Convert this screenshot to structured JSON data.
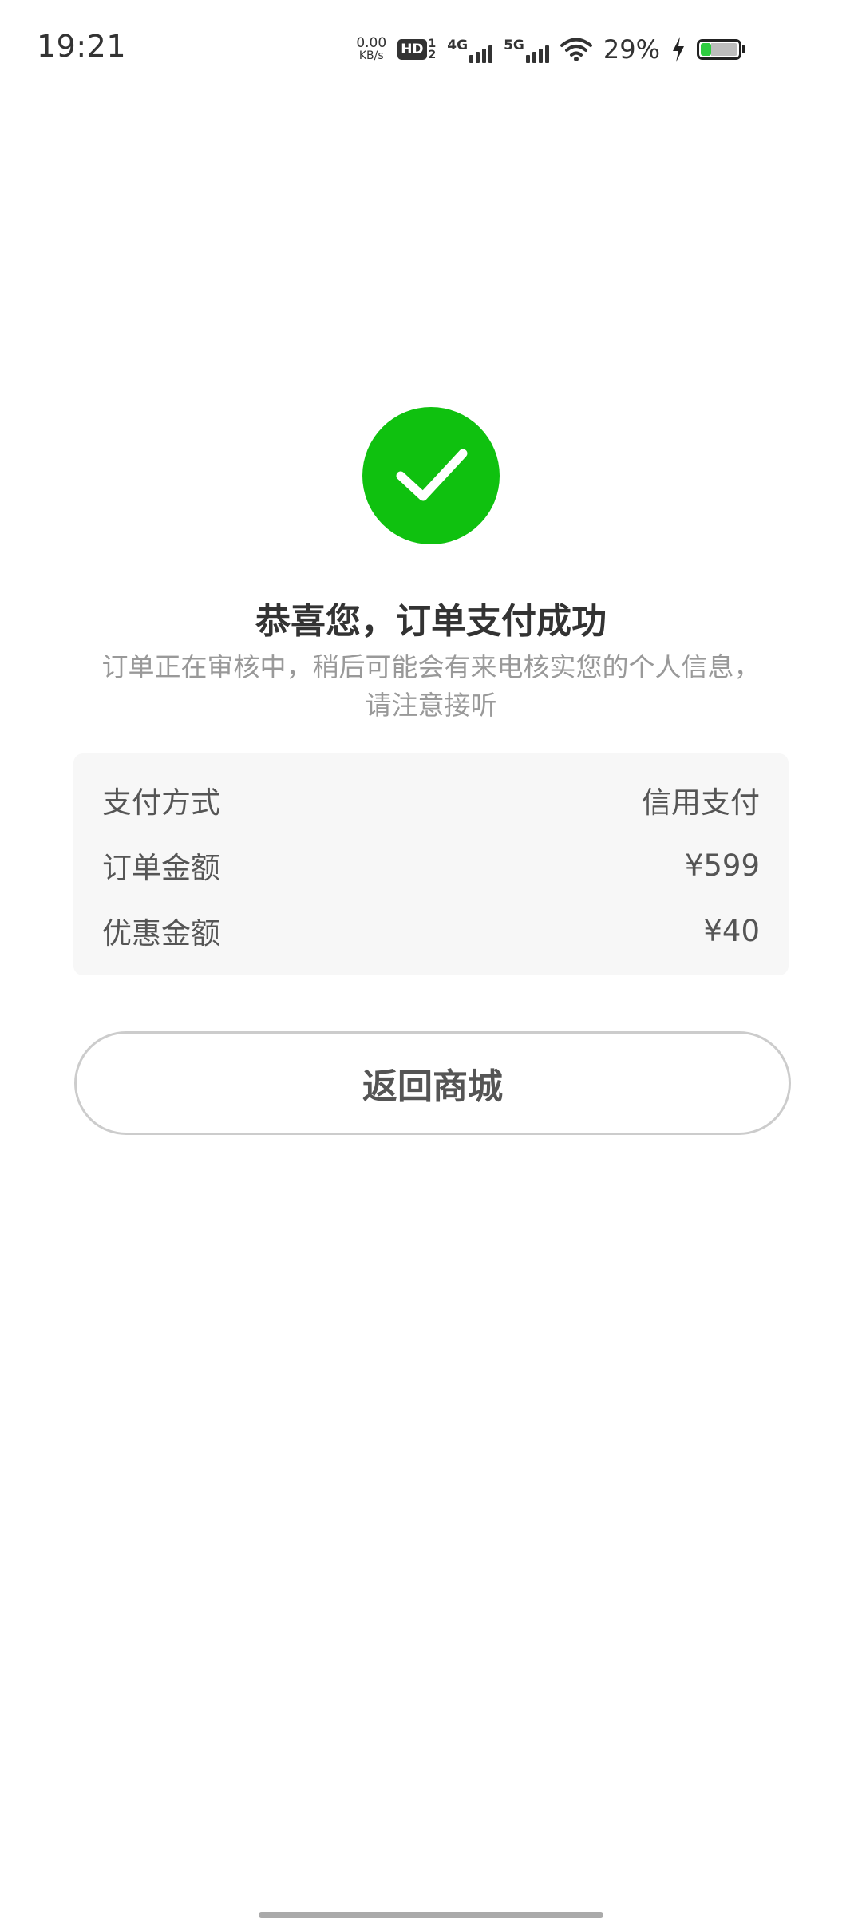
{
  "status_bar": {
    "time": "19:21",
    "net_speed_value": "0.00",
    "net_speed_unit": "KB/s",
    "hd_label": "HD",
    "hd_sim_top": "1",
    "hd_sim_bottom": "2",
    "sim1_network": "4G",
    "sim2_network": "5G",
    "battery_percent": "29%",
    "battery_level": 0.29,
    "icons": [
      "wifi-icon",
      "charging-icon",
      "battery-icon"
    ]
  },
  "result": {
    "icon": "check-icon",
    "icon_color": "#0fc10f",
    "title": "恭喜您，订单支付成功",
    "description_line1": "订单正在审核中，稍后可能会有来电核实您的个人信息，",
    "description_line2": "请注意接听"
  },
  "order_info": {
    "rows": [
      {
        "label": "支付方式",
        "value": "信用支付"
      },
      {
        "label": "订单金额",
        "value": "¥599"
      },
      {
        "label": "优惠金额",
        "value": "¥40"
      }
    ]
  },
  "actions": {
    "back_to_mall_label": "返回商城"
  }
}
